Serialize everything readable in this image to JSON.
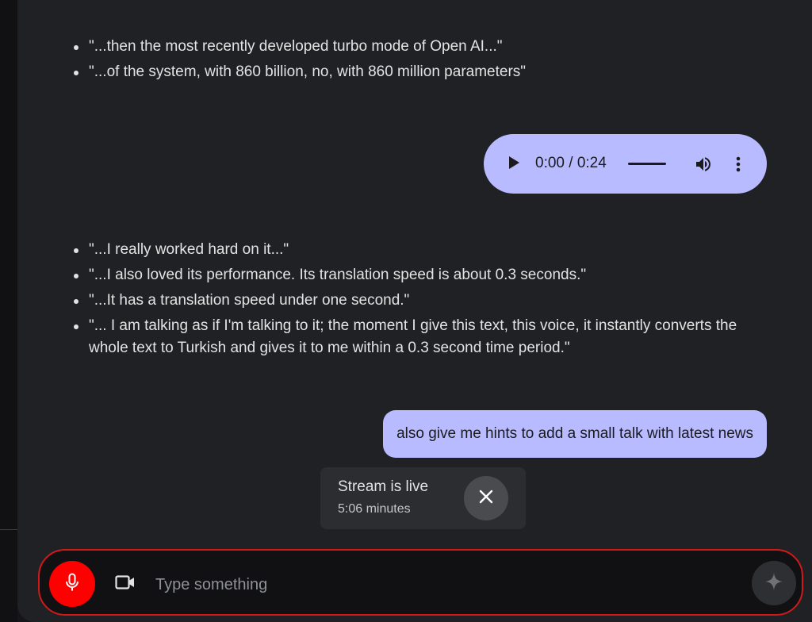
{
  "transcript_list_1": [
    "\"...then the most recently developed turbo mode of Open AI...\"",
    "\"...of the system, with 860 billion, no, with 860 million parameters\""
  ],
  "audio_player": {
    "time": "0:00 / 0:24",
    "play_icon": "play-icon",
    "volume_icon": "volume-icon",
    "more_icon": "more-vert-icon",
    "bubble_color": "#b8bbff"
  },
  "transcript_list_2": [
    "\"...I really worked hard on it...\"",
    "\"...I also loved its performance. Its translation speed is about 0.3 seconds.\"",
    "\"...It has a translation speed under one second.\"",
    "\"... I am talking as if I'm talking to it; the moment I give this text, this voice, it instantly converts the whole text to Turkish and gives it to me within a 0.3 second time period.\""
  ],
  "user_message": "also give me hints to add a small talk with latest news",
  "stream_toast": {
    "title": "Stream is live",
    "duration": "5:06 minutes",
    "close_icon": "close-icon"
  },
  "input_bar": {
    "placeholder": "Type something",
    "value": "",
    "mic_icon": "mic-icon",
    "camera_icon": "videocam-icon",
    "send_icon": "sparkle-icon",
    "mic_color": "#ff0000",
    "border_color": "#d01a1a"
  }
}
